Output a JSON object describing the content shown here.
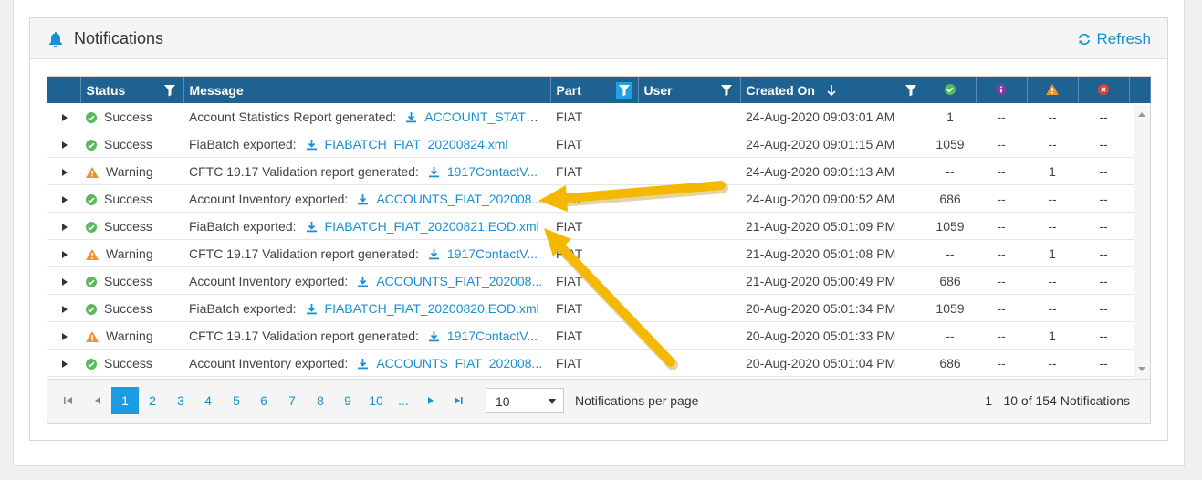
{
  "panel": {
    "title": "Notifications",
    "refresh_label": "Refresh"
  },
  "columns": {
    "status": "Status",
    "message": "Message",
    "part": "Part",
    "user": "User",
    "created_on": "Created On"
  },
  "rows": [
    {
      "status": "Success",
      "type": "success",
      "msg": "Account Statistics Report generated:",
      "file": "ACCOUNT_STATS_...",
      "part": "FIAT",
      "user": "",
      "created": "24-Aug-2020 09:03:01 AM",
      "ok": "1",
      "info": "--",
      "warn": "--",
      "err": "--"
    },
    {
      "status": "Success",
      "type": "success",
      "msg": "FiaBatch exported:",
      "file": "FIABATCH_FIAT_20200824.xml",
      "part": "FIAT",
      "user": "",
      "created": "24-Aug-2020 09:01:15 AM",
      "ok": "1059",
      "info": "--",
      "warn": "--",
      "err": "--"
    },
    {
      "status": "Warning",
      "type": "warning",
      "msg": "CFTC 19.17 Validation report generated:",
      "file": "1917ContactV...",
      "part": "FIAT",
      "user": "",
      "created": "24-Aug-2020 09:01:13 AM",
      "ok": "--",
      "info": "--",
      "warn": "1",
      "err": "--"
    },
    {
      "status": "Success",
      "type": "success",
      "msg": "Account Inventory exported:",
      "file": "ACCOUNTS_FIAT_202008...",
      "part": "FIAT",
      "user": "",
      "created": "24-Aug-2020 09:00:52 AM",
      "ok": "686",
      "info": "--",
      "warn": "--",
      "err": "--"
    },
    {
      "status": "Success",
      "type": "success",
      "msg": "FiaBatch exported:",
      "file": "FIABATCH_FIAT_20200821.EOD.xml",
      "part": "FIAT",
      "user": "",
      "created": "21-Aug-2020 05:01:09 PM",
      "ok": "1059",
      "info": "--",
      "warn": "--",
      "err": "--"
    },
    {
      "status": "Warning",
      "type": "warning",
      "msg": "CFTC 19.17 Validation report generated:",
      "file": "1917ContactV...",
      "part": "FIAT",
      "user": "",
      "created": "21-Aug-2020 05:01:08 PM",
      "ok": "--",
      "info": "--",
      "warn": "1",
      "err": "--"
    },
    {
      "status": "Success",
      "type": "success",
      "msg": "Account Inventory exported:",
      "file": "ACCOUNTS_FIAT_202008...",
      "part": "FIAT",
      "user": "",
      "created": "21-Aug-2020 05:00:49 PM",
      "ok": "686",
      "info": "--",
      "warn": "--",
      "err": "--"
    },
    {
      "status": "Success",
      "type": "success",
      "msg": "FiaBatch exported:",
      "file": "FIABATCH_FIAT_20200820.EOD.xml",
      "part": "FIAT",
      "user": "",
      "created": "20-Aug-2020 05:01:34 PM",
      "ok": "1059",
      "info": "--",
      "warn": "--",
      "err": "--"
    },
    {
      "status": "Warning",
      "type": "warning",
      "msg": "CFTC 19.17 Validation report generated:",
      "file": "1917ContactV...",
      "part": "FIAT",
      "user": "",
      "created": "20-Aug-2020 05:01:33 PM",
      "ok": "--",
      "info": "--",
      "warn": "1",
      "err": "--"
    },
    {
      "status": "Success",
      "type": "success",
      "msg": "Account Inventory exported:",
      "file": "ACCOUNTS_FIAT_202008...",
      "part": "FIAT",
      "user": "",
      "created": "20-Aug-2020 05:01:04 PM",
      "ok": "686",
      "info": "--",
      "warn": "--",
      "err": "--"
    }
  ],
  "pager": {
    "pages": [
      "1",
      "2",
      "3",
      "4",
      "5",
      "6",
      "7",
      "8",
      "9",
      "10",
      "..."
    ],
    "current": "1",
    "page_size": "10",
    "per_page_label": "Notifications per page",
    "summary": "1 - 10 of 154 Notifications"
  },
  "colors": {
    "header": "#1e6292",
    "accent": "#1a8fd1",
    "success": "#5cb85c",
    "warning": "#f0932b",
    "info": "#7b3fa0",
    "error": "#e0403a",
    "annotation_arrow": "#f5b800"
  },
  "icons": {
    "title": "bell-icon",
    "refresh": "refresh-icon",
    "filter": "filter-icon",
    "sort": "sort-down-icon",
    "download": "download-icon"
  }
}
